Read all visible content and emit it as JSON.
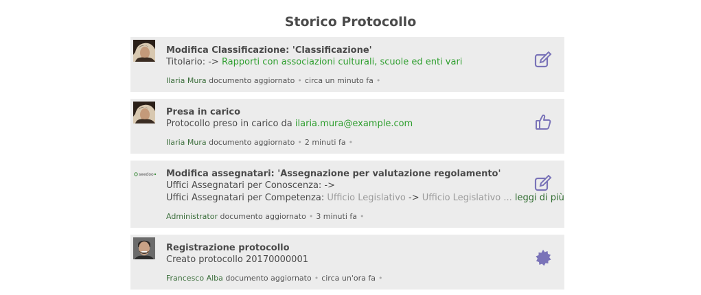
{
  "page": {
    "title": "Storico Protocollo"
  },
  "colors": {
    "accent": "#7a73b8",
    "link_green": "#2e9e2e",
    "card_bg": "#ececec"
  },
  "entries": [
    {
      "icon": "edit-icon",
      "heading": "Modifica Classificazione: 'Classificazione'",
      "line1_prefix": "Titolario: ->",
      "line1_link": "Rapporti con associazioni culturali, scuole ed enti vari",
      "user": "Ilaria Mura",
      "action": "documento aggiornato",
      "time": "circa un minuto fa"
    },
    {
      "icon": "thumbs-up-icon",
      "heading": "Presa in carico",
      "line1_prefix": "Protocollo preso in carico da",
      "line1_link": "ilaria.mura@example.com",
      "user": "Ilaria Mura",
      "action": "documento aggiornato",
      "time": "2 minuti fa"
    },
    {
      "icon": "edit-icon",
      "avatar_text": "seedoo",
      "heading": "Modifica assegnatari: 'Assegnazione per valutazione regolamento'",
      "line1_prefix": "Uffici Assegnatari per Conoscenza: ->",
      "line2_prefix": "Uffici Assegnatari per Competenza:",
      "line2_old": "Ufficio Legislativo",
      "line2_arrow": "->",
      "line2_new": "Ufficio Legislativo ...",
      "read_more": "leggi di più",
      "user": "Administrator",
      "action": "documento aggiornato",
      "time": "3 minuti fa"
    },
    {
      "icon": "badge-icon",
      "heading": "Registrazione protocollo",
      "line1_prefix": "Creato protocollo 20170000001",
      "user": "Francesco Alba",
      "action": "documento aggiornato",
      "time": "circa un'ora fa"
    }
  ]
}
